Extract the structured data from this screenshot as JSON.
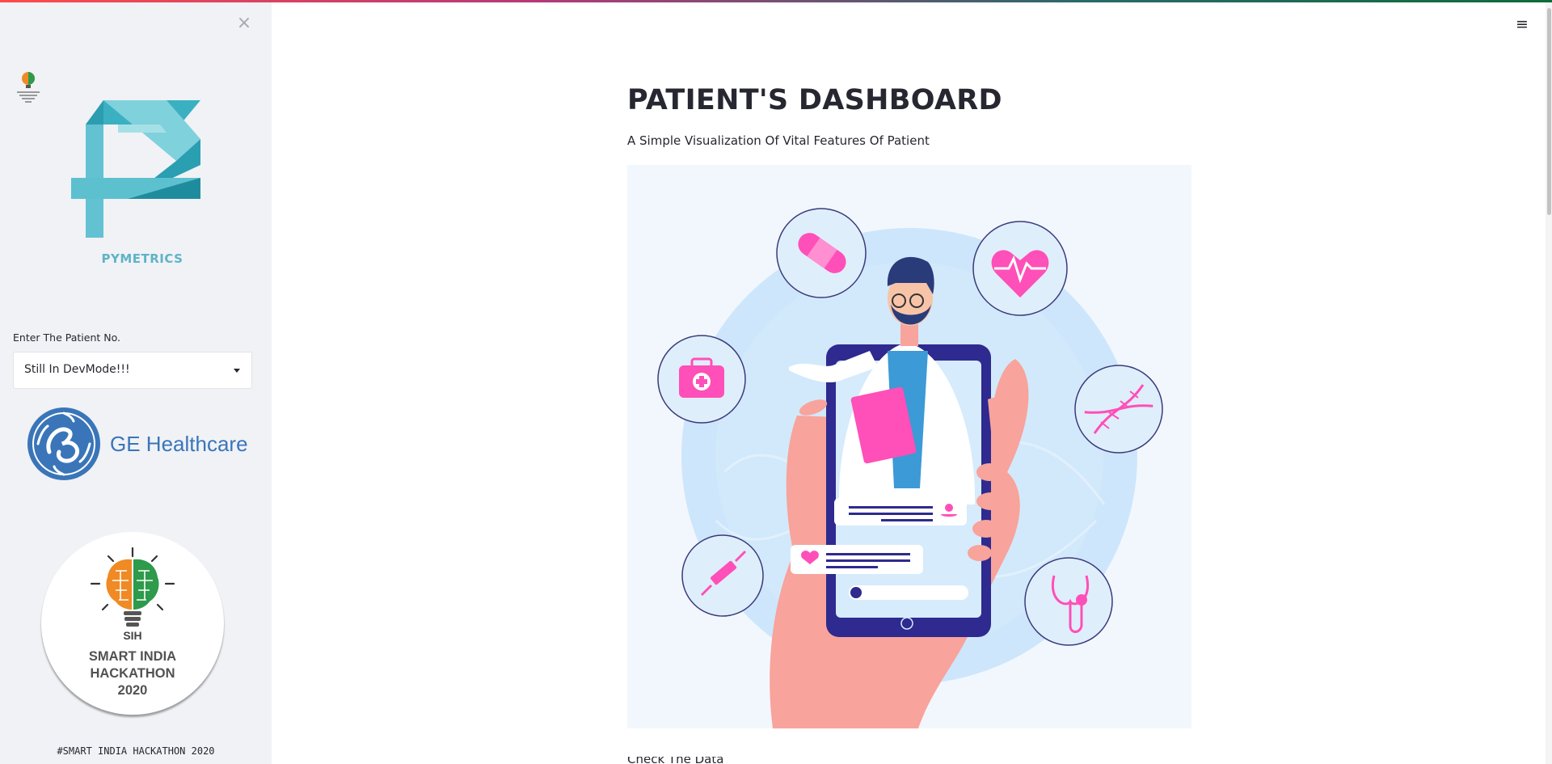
{
  "sidebar": {
    "close_icon": "close-icon",
    "pymetrics_text": "PYMETRICS",
    "patient_label": "Enter The Patient No.",
    "patient_select_value": "Still In DevMode!!!",
    "ge_text": "GE Healthcare",
    "sih_badge": {
      "line1": "SMART INDIA",
      "line2": "HACKATHON",
      "line3": "2020",
      "brain_label": "SIH"
    },
    "footer": "#SMART INDIA HACKATHON 2020"
  },
  "main": {
    "title": "PATIENT'S DASHBOARD",
    "subtitle": "A Simple Visualization Of Vital Features Of Patient",
    "menu_icon": "hamburger-menu-icon",
    "cut_off_text": "Check The Data"
  },
  "colors": {
    "accent_pink": "#ff4fb8",
    "illustration_bg": "#f2f7fd",
    "circle_bg": "#cde6fb",
    "phone": "#2e2a8f",
    "pymetrics_teal": "#5fb3c7",
    "ge_blue": "#3a75b9"
  }
}
